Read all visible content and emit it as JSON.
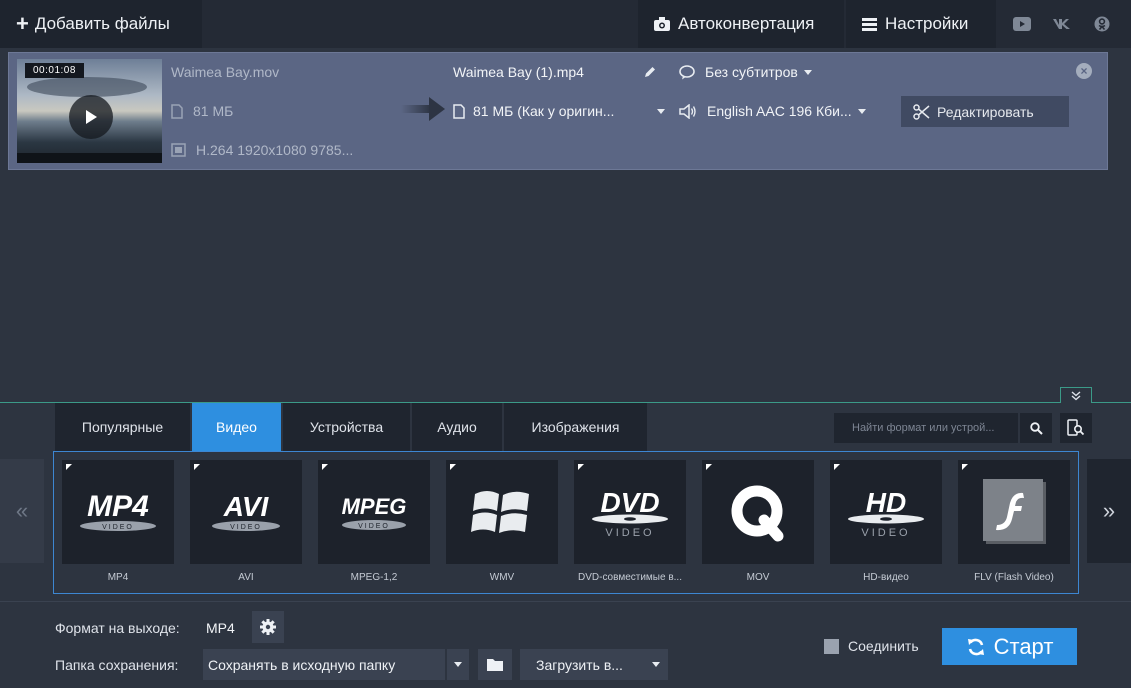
{
  "topbar": {
    "add_files": "Добавить файлы",
    "autoconvert": "Автоконвертация",
    "settings": "Настройки",
    "social_icons": [
      "youtube-icon",
      "vk-icon",
      "ok-icon"
    ]
  },
  "file": {
    "duration": "00:01:08",
    "source_name": "Waimea Bay.mov",
    "source_size": "81 МБ",
    "source_codec": "H.264 1920x1080 9785...",
    "output_name": "Waimea Bay (1).mp4",
    "output_size": "81 МБ (Как у оригин...",
    "subtitles": "Без субтитров",
    "audio": "English AAC 196 Кби...",
    "edit": "Редактировать"
  },
  "tabs": [
    {
      "label": "Популярные",
      "active": false
    },
    {
      "label": "Видео",
      "active": true
    },
    {
      "label": "Устройства",
      "active": false
    },
    {
      "label": "Аудио",
      "active": false
    },
    {
      "label": "Изображения",
      "active": false
    }
  ],
  "search": {
    "placeholder": "Найти формат или устрой..."
  },
  "formats": [
    {
      "label": "MP4",
      "logo": "MP4"
    },
    {
      "label": "AVI",
      "logo": "AVI"
    },
    {
      "label": "MPEG-1,2",
      "logo": "MPEG"
    },
    {
      "label": "WMV",
      "logo": "windows-logo"
    },
    {
      "label": "DVD-совместимые в...",
      "logo": "DVD"
    },
    {
      "label": "MOV",
      "logo": "quicktime-logo"
    },
    {
      "label": "HD-видео",
      "logo": "HD"
    },
    {
      "label": "FLV (Flash Video)",
      "logo": "flash-logo"
    }
  ],
  "logo_sub": {
    "video": "VIDEO"
  },
  "footer": {
    "format_label": "Формат на выходе:",
    "format_value": "MP4",
    "folder_label": "Папка сохранения:",
    "folder_value": "Сохранять в исходную папку",
    "upload": "Загрузить в...",
    "join": "Соединить",
    "start": "Старт"
  },
  "colors": {
    "accent": "#2e8fe0",
    "file_row": "#5b6684",
    "background": "#2d3440",
    "divider": "#3b9a88"
  }
}
